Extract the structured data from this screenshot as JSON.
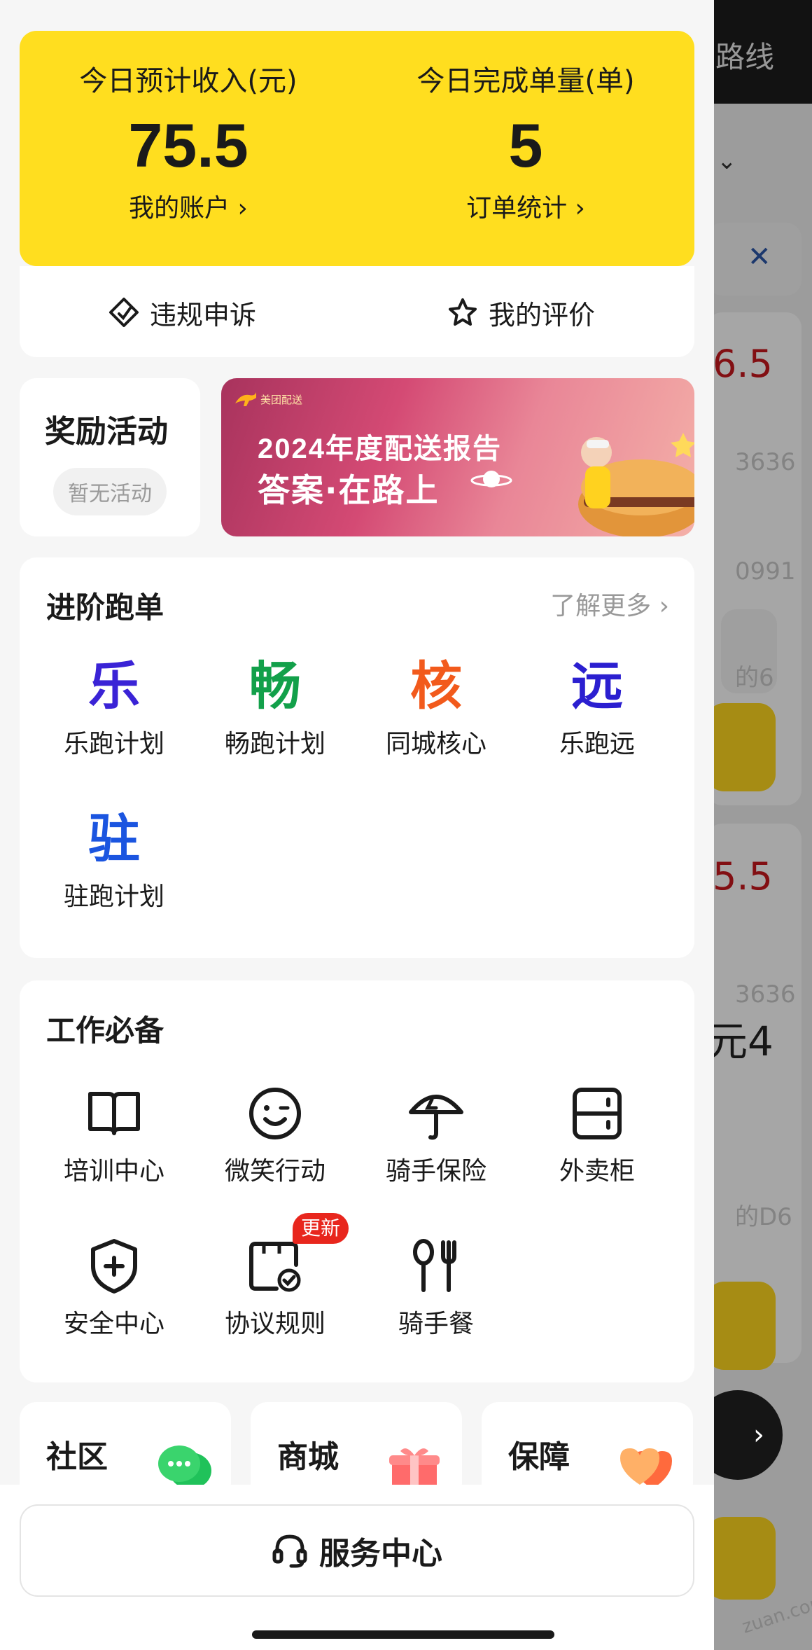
{
  "background": {
    "title": "路线",
    "amount_1": "6.5",
    "amount_2": "5.5",
    "fragment": "元4",
    "faint": [
      "3636",
      "0991",
      "的6",
      "3636",
      "的D6"
    ],
    "watermark": "zuan.com"
  },
  "stats": {
    "income_label": "今日预计收入(元)",
    "income_value": "75.5",
    "income_link": "我的账户 ›",
    "orders_label": "今日完成单量(单)",
    "orders_value": "5",
    "orders_link": "订单统计 ›"
  },
  "actions": {
    "appeal": "违规申诉",
    "rating": "我的评价"
  },
  "reward": {
    "title": "奖励活动",
    "status": "暂无活动"
  },
  "banner": {
    "brand": "美团配送",
    "line1": "2024年度配送报告",
    "line2": "答案·在路上"
  },
  "advanced": {
    "title": "进阶跑单",
    "more": "了解更多 ›",
    "items": [
      {
        "glyph": "乐",
        "label": "乐跑计划",
        "color": "#3a23d6"
      },
      {
        "glyph": "畅",
        "label": "畅跑计划",
        "color": "#12a04a"
      },
      {
        "glyph": "核",
        "label": "同城核心",
        "color": "#f25a1c"
      },
      {
        "glyph": "远",
        "label": "乐跑远",
        "color": "#2b1fd0"
      },
      {
        "glyph": "驻",
        "label": "驻跑计划",
        "color": "#1b55e0"
      }
    ]
  },
  "work": {
    "title": "工作必备",
    "items": [
      {
        "label": "培训中心",
        "icon": "book-icon"
      },
      {
        "label": "微笑行动",
        "icon": "smile-icon"
      },
      {
        "label": "骑手保险",
        "icon": "umbrella-icon"
      },
      {
        "label": "外卖柜",
        "icon": "locker-icon"
      },
      {
        "label": "安全中心",
        "icon": "shield-plus-icon"
      },
      {
        "label": "协议规则",
        "icon": "agreement-icon",
        "badge": "更新"
      },
      {
        "label": "骑手餐",
        "icon": "cutlery-icon"
      }
    ]
  },
  "mini_cards": [
    {
      "title": "社区",
      "icon": "chat-bubbles-icon"
    },
    {
      "title": "商城",
      "icon": "gift-icon"
    },
    {
      "title": "保障",
      "icon": "hearts-icon"
    }
  ],
  "service": {
    "label": "服务中心",
    "icon": "headset-icon"
  }
}
